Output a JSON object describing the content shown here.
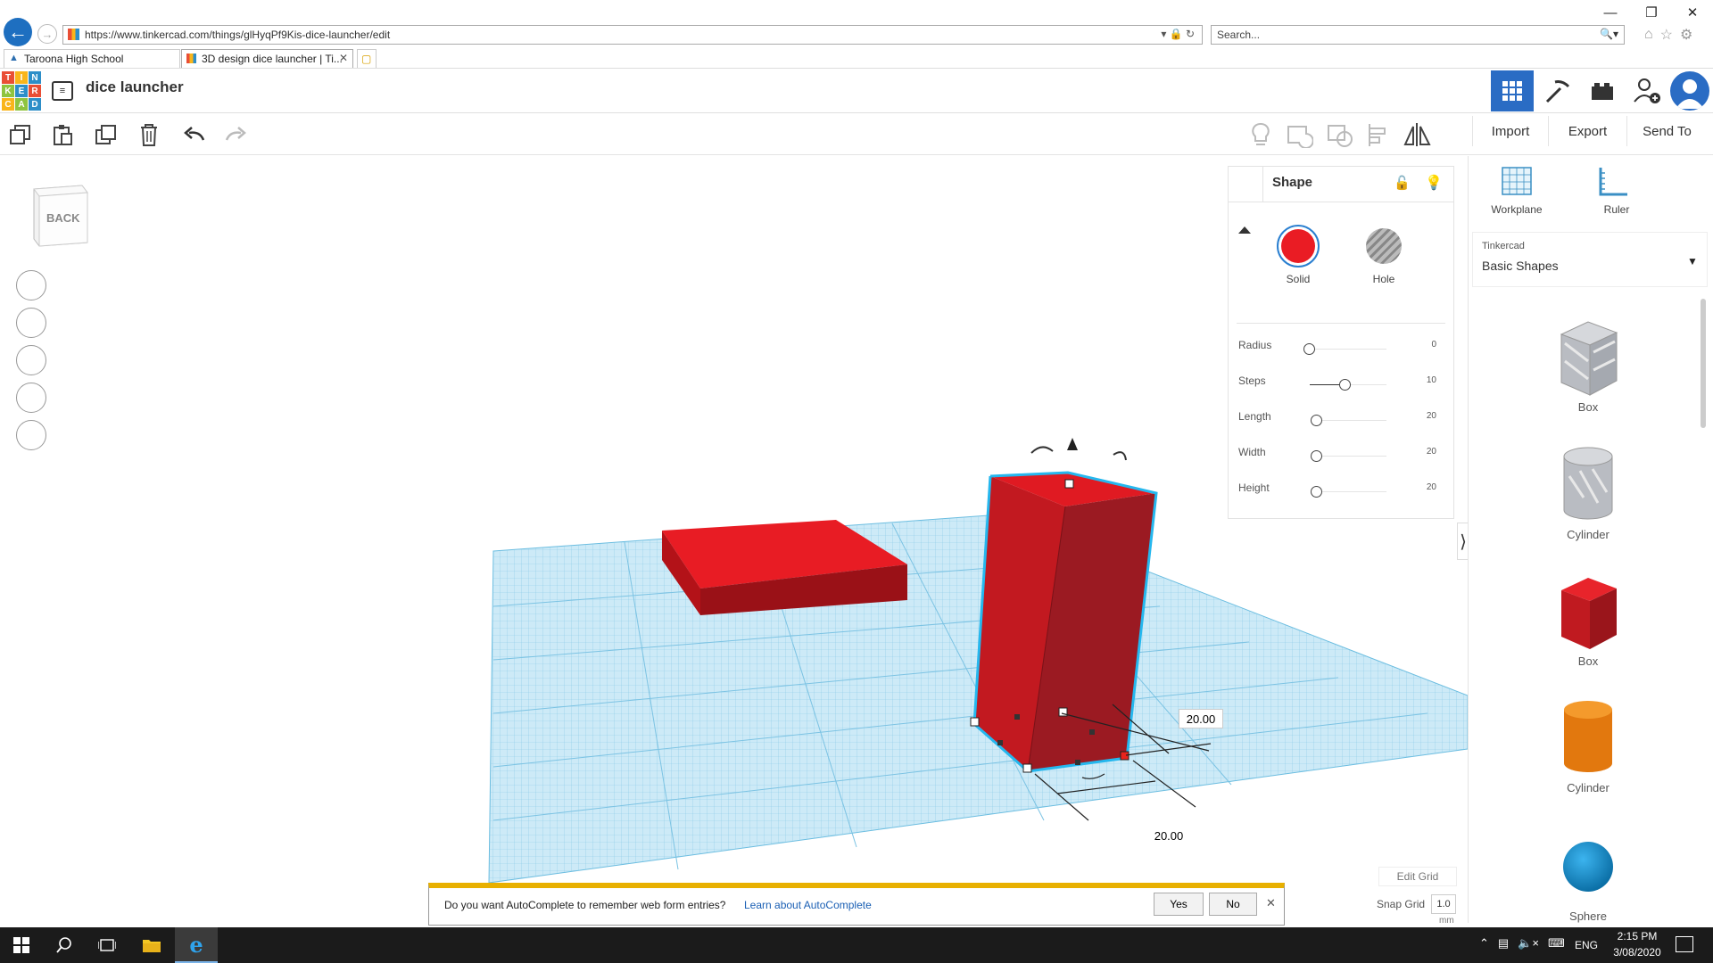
{
  "browser": {
    "url": "https://www.tinkercad.com/things/glHyqPf9Kis-dice-launcher/edit",
    "search_placeholder": "Search...",
    "tabs": [
      {
        "label": "Taroona High School"
      },
      {
        "label": "3D design dice launcher | Ti..."
      }
    ]
  },
  "app": {
    "design_title": "dice launcher",
    "logo_letters": [
      "T",
      "I",
      "N",
      "K",
      "E",
      "R",
      "C",
      "A",
      "D"
    ],
    "logo_colors": [
      "#e94e35",
      "#f9b51b",
      "#2d8ec8",
      "#8fc43f",
      "#2d8ec8",
      "#e94e35",
      "#f9b51b",
      "#8fc43f",
      "#2d8ec8"
    ],
    "toolbar": {
      "import_label": "Import",
      "export_label": "Export",
      "sendto_label": "Send To"
    },
    "viewcube_label": "BACK",
    "inspector": {
      "title": "Shape",
      "solid_label": "Solid",
      "hole_label": "Hole",
      "solid_color": "#ea1c24",
      "params": [
        {
          "label": "Radius",
          "value": "0"
        },
        {
          "label": "Steps",
          "value": "10"
        },
        {
          "label": "Length",
          "value": "20"
        },
        {
          "label": "Width",
          "value": "20"
        },
        {
          "label": "Height",
          "value": "20"
        }
      ]
    },
    "dimensions": {
      "a": "20.00",
      "b": "20.00"
    },
    "right_panel": {
      "workplane_label": "Workplane",
      "ruler_label": "Ruler",
      "library_small": "Tinkercad",
      "library_name": "Basic Shapes",
      "shapes": [
        {
          "label": "Box",
          "icon": "box-hole-icon"
        },
        {
          "label": "Cylinder",
          "icon": "cylinder-hole-icon"
        },
        {
          "label": "Box",
          "icon": "box-solid-icon"
        },
        {
          "label": "Cylinder",
          "icon": "cylinder-solid-icon"
        },
        {
          "label": "Sphere",
          "icon": "sphere-icon"
        }
      ]
    },
    "grid": {
      "edit_label": "Edit Grid",
      "snap_label": "Snap Grid",
      "snap_value": "1.0",
      "snap_unit": "mm"
    }
  },
  "autocomplete": {
    "message": "Do you want AutoComplete to remember web form entries?",
    "learn_link": "Learn about AutoComplete",
    "yes_label": "Yes",
    "no_label": "No"
  },
  "taskbar": {
    "lang": "ENG",
    "time": "2:15 PM",
    "date": "3/08/2020"
  }
}
